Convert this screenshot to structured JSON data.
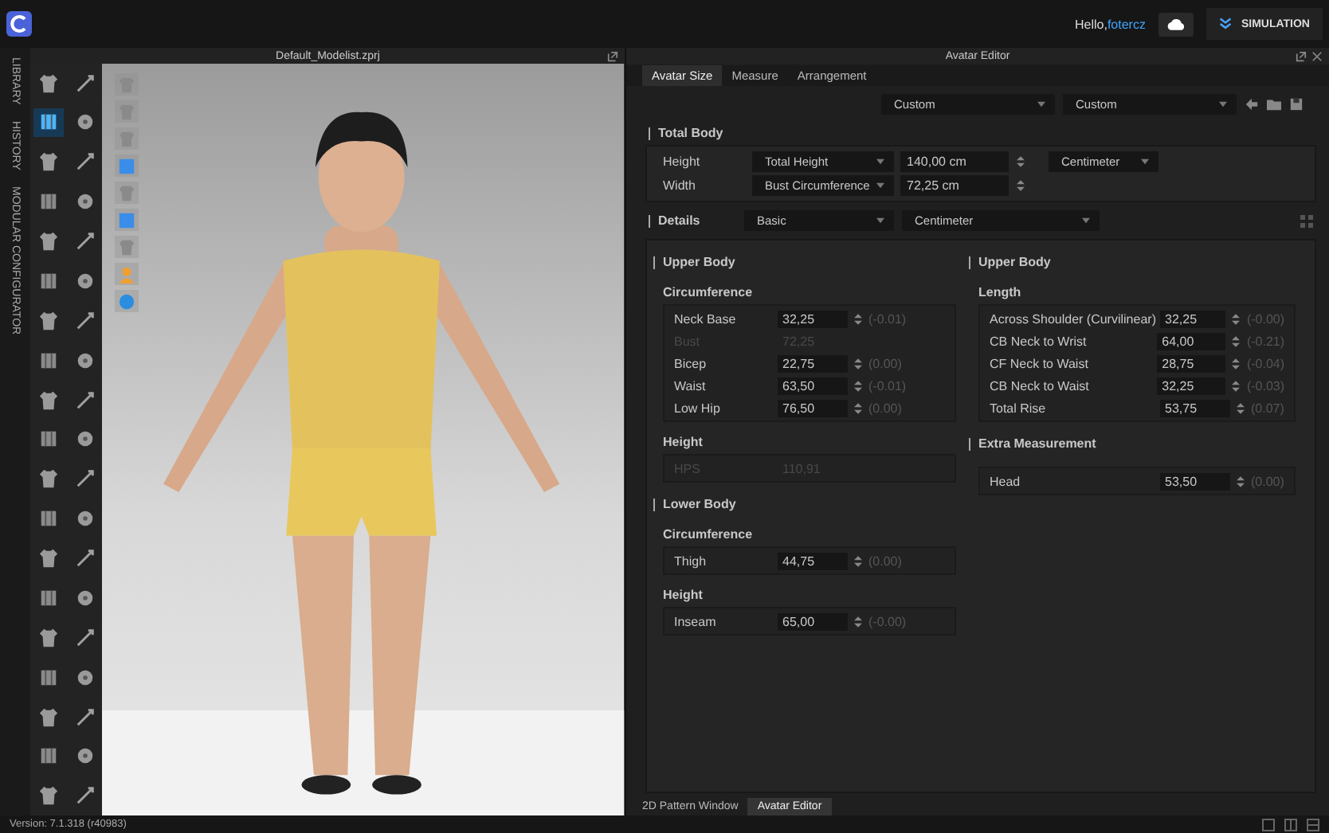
{
  "app_bar": {
    "greeting": "Hello,",
    "user": "fotercz",
    "simulation_button": "SIMULATION"
  },
  "side_tabs": [
    "LIBRARY",
    "HISTORY",
    "MODULAR CONFIGURATOR"
  ],
  "toolbar": [
    {
      "selected": false
    },
    {
      "selected": false
    },
    {
      "selected": true
    },
    {
      "selected": false
    },
    {
      "selected": false
    },
    {
      "selected": false
    },
    {
      "selected": false
    },
    {
      "selected": false
    },
    {
      "selected": false
    },
    {
      "selected": false
    },
    {
      "selected": false
    },
    {
      "selected": false
    },
    {
      "selected": false
    },
    {
      "selected": false
    },
    {
      "selected": false
    },
    {
      "selected": false
    },
    {
      "selected": false
    },
    {
      "selected": false
    },
    {
      "selected": false
    },
    {
      "selected": false
    },
    {
      "selected": false
    },
    {
      "selected": false
    },
    {
      "selected": false
    },
    {
      "selected": false
    },
    {
      "selected": false
    },
    {
      "selected": false
    },
    {
      "selected": false
    },
    {
      "selected": false
    },
    {
      "selected": false
    },
    {
      "selected": false
    },
    {
      "selected": false
    },
    {
      "selected": false
    },
    {
      "selected": false
    },
    {
      "selected": false
    },
    {
      "selected": false
    },
    {
      "selected": false
    },
    {
      "selected": false
    },
    {
      "selected": false
    }
  ],
  "viewport": {
    "title": "Default_Modelist.zprj"
  },
  "avatar_editor": {
    "title": "Avatar Editor",
    "tabs": [
      {
        "label": "Avatar Size",
        "selected": true
      },
      {
        "label": "Measure",
        "selected": false
      },
      {
        "label": "Arrangement",
        "selected": false
      }
    ],
    "presets": [
      "Custom",
      "Custom"
    ],
    "total_body": {
      "heading": "Total Body",
      "rows": [
        {
          "label": "Height",
          "measure": "Total Height",
          "value": "140,00 cm",
          "unit": "Centimeter"
        },
        {
          "label": "Width",
          "measure": "Bust Circumference",
          "value": "72,25 cm"
        }
      ]
    },
    "details": {
      "heading": "Details",
      "mode": "Basic",
      "unit": "Centimeter",
      "columns": [
        [
          {
            "heading": "Upper Body",
            "groups": [
              {
                "title": "Circumference",
                "fields": [
                  {
                    "label": "Neck Base",
                    "value": "32,25",
                    "delta": "(-0.01)",
                    "disabled": false
                  },
                  {
                    "label": "Bust",
                    "value": "72,25",
                    "disabled": true
                  },
                  {
                    "label": "Bicep",
                    "value": "22,75",
                    "delta": "(0.00)",
                    "disabled": false
                  },
                  {
                    "label": "Waist",
                    "value": "63,50",
                    "delta": "(-0.01)",
                    "disabled": false
                  },
                  {
                    "label": "Low Hip",
                    "value": "76,50",
                    "delta": "(0.00)",
                    "disabled": false
                  }
                ]
              },
              {
                "title": "Height",
                "fields": [
                  {
                    "label": "HPS",
                    "value": "110,91",
                    "disabled": true
                  }
                ]
              }
            ]
          },
          {
            "heading": "Lower Body",
            "groups": [
              {
                "title": "Circumference",
                "fields": [
                  {
                    "label": "Thigh",
                    "value": "44,75",
                    "delta": "(0.00)",
                    "disabled": false
                  }
                ]
              },
              {
                "title": "Height",
                "fields": [
                  {
                    "label": "Inseam",
                    "value": "65,00",
                    "delta": "(-0.00)",
                    "disabled": false
                  }
                ]
              }
            ]
          }
        ],
        [
          {
            "heading": "Upper Body",
            "groups": [
              {
                "title": "Length",
                "fields": [
                  {
                    "label": "Across Shoulder (Curvilinear)",
                    "value": "32,25",
                    "delta": "(-0.00)",
                    "disabled": false
                  },
                  {
                    "label": "CB Neck to Wrist",
                    "value": "64,00",
                    "delta": "(-0.21)",
                    "disabled": false
                  },
                  {
                    "label": "CF Neck to Waist",
                    "value": "28,75",
                    "delta": "(-0.04)",
                    "disabled": false
                  },
                  {
                    "label": "CB Neck to Waist",
                    "value": "32,25",
                    "delta": "(-0.03)",
                    "disabled": false
                  },
                  {
                    "label": "Total Rise",
                    "value": "53,75",
                    "delta": "(0.07)",
                    "disabled": false
                  }
                ]
              }
            ]
          },
          {
            "heading": "Extra Measurement",
            "groups": [
              {
                "fields": [
                  {
                    "label": "Head",
                    "value": "53,50",
                    "delta": "(0.00)",
                    "disabled": false
                  }
                ]
              }
            ]
          }
        ]
      ]
    }
  },
  "bottom_tabs": [
    {
      "label": "2D Pattern Window",
      "selected": false
    },
    {
      "label": "Avatar Editor",
      "selected": true
    }
  ],
  "status_bar": {
    "version": "Version: 7.1.318 (r40983)"
  }
}
